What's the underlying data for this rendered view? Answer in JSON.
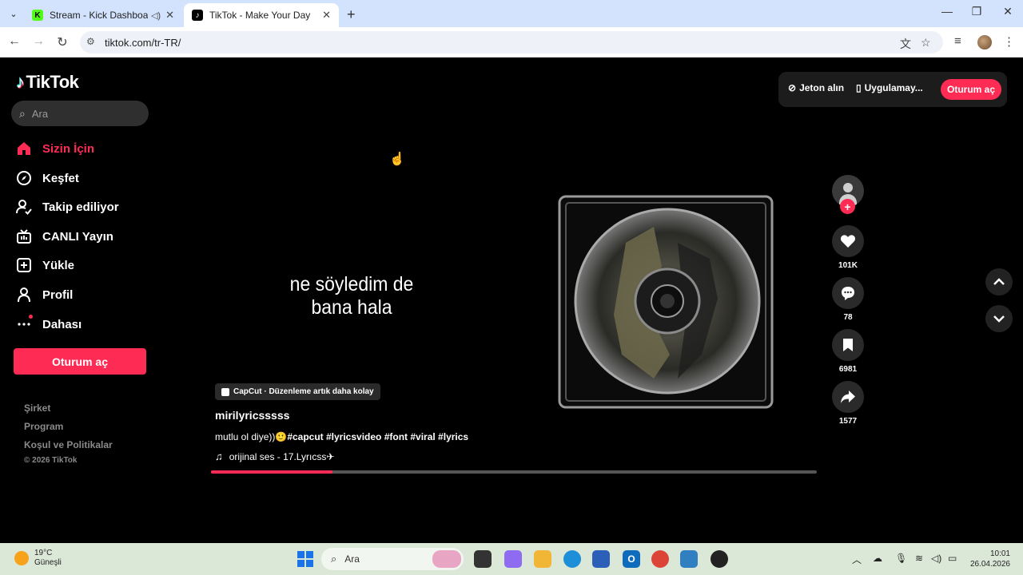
{
  "browser": {
    "tabs": [
      {
        "title": "Stream - Kick Dashboard",
        "favicon": "kick-icon"
      },
      {
        "title": "TikTok - Make Your Day",
        "favicon": "tiktok-icon"
      }
    ],
    "url": "tiktok.com/tr-TR/"
  },
  "tiktok": {
    "logo": "TikTok",
    "search_placeholder": "Ara",
    "nav": [
      {
        "label": "Sizin İçin",
        "icon": "home-icon"
      },
      {
        "label": "Keşfet",
        "icon": "compass-icon"
      },
      {
        "label": "Takip ediliyor",
        "icon": "following-icon"
      },
      {
        "label": "CANLI Yayın",
        "icon": "live-icon"
      },
      {
        "label": "Yükle",
        "icon": "upload-icon"
      },
      {
        "label": "Profil",
        "icon": "profile-icon"
      },
      {
        "label": "Dahası",
        "icon": "more-icon"
      }
    ],
    "login_label": "Oturum aç",
    "footer": [
      "Şirket",
      "Program",
      "Koşul ve Politikalar"
    ],
    "copyright": "© 2026 TikTok",
    "topbar": {
      "coins": "Jeton alın",
      "app": "Uygulamay...",
      "login": "Oturum aç"
    },
    "video": {
      "lyric_line1": "ne söyledim de",
      "lyric_line2": "bana hala",
      "capcut": "CapCut · Düzenleme artık daha kolay",
      "author": "mirilyricsssss",
      "caption_text": "mutlu ol diye))🙂",
      "hashtags": "#capcut  #lyricsvideo  #font #viral #lyrics",
      "music": "orijinal ses - 17.Lyrıcss✈",
      "progress": 0.2
    },
    "actions": {
      "likes": "101K",
      "comments": "78",
      "saves": "6981",
      "shares": "1577"
    }
  },
  "taskbar": {
    "temp": "19°C",
    "weather": "Güneşli",
    "search": "Ara",
    "time": "10:01",
    "date": "26.04.2026"
  },
  "colors": {
    "accent": "#fe2c55",
    "background": "#000000"
  }
}
